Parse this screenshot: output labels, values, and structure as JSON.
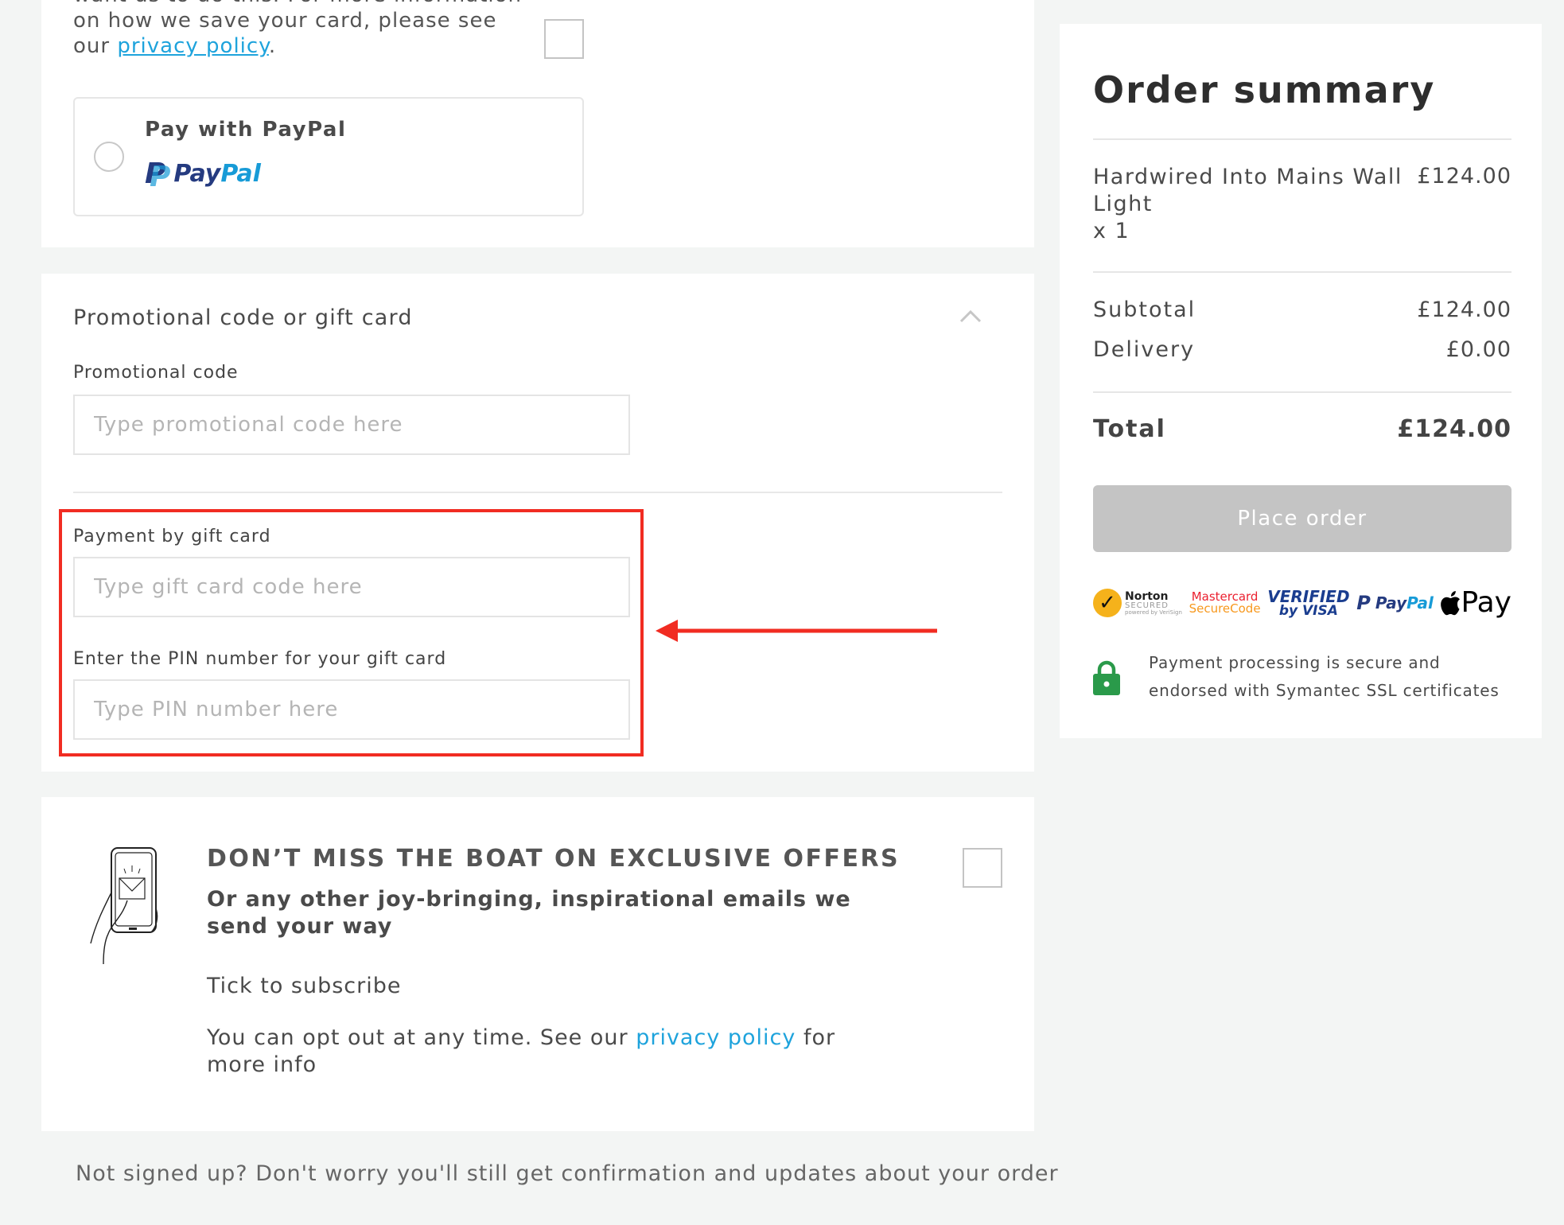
{
  "card_save": {
    "text_line_top": "want us to do this. For more information",
    "text_before_link": "on how we save your card, please see our ",
    "link": "privacy policy",
    "text_after_link": "."
  },
  "paypal": {
    "label": "Pay with PayPal",
    "logo_pay": "Pay",
    "logo_pal": "Pal",
    "logo_mark": "P"
  },
  "promo": {
    "header": "Promotional code or gift card",
    "chevron_icon": "chevron-up-icon",
    "promo_label": "Promotional code",
    "promo_placeholder": "Type promotional code here",
    "gift_label": "Payment by gift card",
    "gift_placeholder": "Type gift card code here",
    "pin_label": "Enter the PIN number for your gift card",
    "pin_placeholder": "Type PIN number here"
  },
  "annotation": {
    "highlight_color": "#f12c22"
  },
  "newsletter": {
    "title": "DON’T MISS THE BOAT ON EXCLUSIVE OFFERS",
    "subtitle": "Or any other joy-bringing, inspirational emails we send your way",
    "tick_text": "Tick to subscribe",
    "optout_before": "You can opt out at any time. See our ",
    "optout_link": "privacy policy",
    "optout_after": " for more info"
  },
  "footer_note": "Not signed up? Don't worry you'll still get confirmation and updates about your order",
  "summary": {
    "title": "Order summary",
    "item_name": "Hardwired Into Mains Wall Light",
    "item_qty": "x 1",
    "item_price": "£124.00",
    "subtotal_label": "Subtotal",
    "subtotal_value": "£124.00",
    "delivery_label": "Delivery",
    "delivery_value": "£0.00",
    "total_label": "Total",
    "total_value": "£124.00",
    "place_order": "Place order",
    "badges": {
      "norton": "Norton",
      "norton_sub": "SECURED",
      "norton_powered": "powered by VeriSign",
      "mastercard_1": "Mastercard",
      "mastercard_2": "SecureCode",
      "visa_1": "VERIFIED",
      "visa_2": "by VISA",
      "paypal_pay": "Pay",
      "paypal_pal": "Pal",
      "apple_pay": "Pay"
    },
    "secure_text": "Payment processing is secure and endorsed with Symantec SSL certificates"
  },
  "colors": {
    "link": "#1ea3dc",
    "background": "#f3f5f4",
    "button_disabled": "#c4c4c4",
    "lock": "#2a9a4a"
  }
}
